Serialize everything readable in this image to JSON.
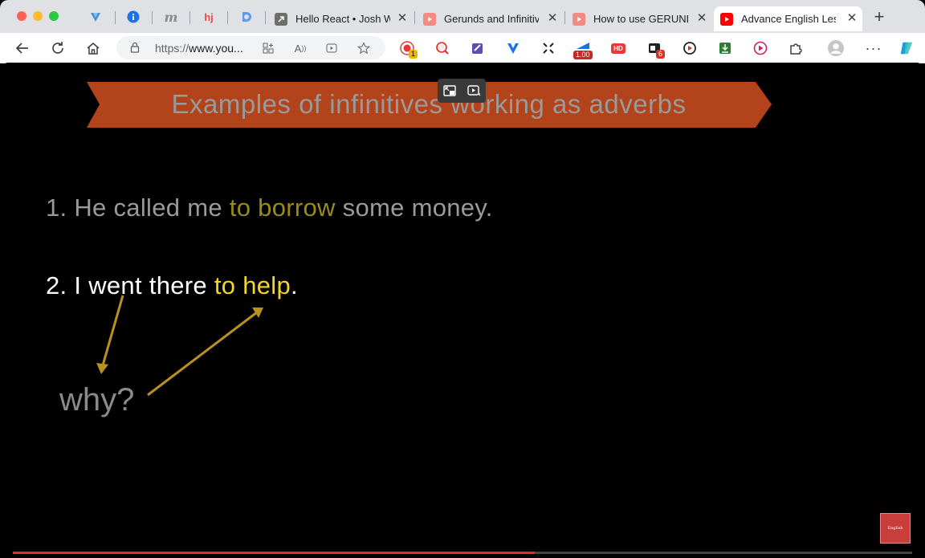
{
  "browser": {
    "tabs": [
      {
        "title": "Hello React • Josh W",
        "favicon": "arrow-icon"
      },
      {
        "title": "Gerunds and Infinitive",
        "favicon": "youtube-icon"
      },
      {
        "title": "How to use GERUNDS",
        "favicon": "youtube-icon"
      },
      {
        "title": "Advance English Lesso",
        "favicon": "youtube-icon",
        "active": true
      }
    ],
    "pinned": [
      "vivaldi-icon",
      "info-icon",
      "m-icon",
      "hj-icon",
      "d-icon"
    ],
    "pinned_text": {
      "m": "m",
      "hj": "hj"
    },
    "address": {
      "scheme": "https://",
      "host": "www.you..."
    },
    "extensions": {
      "badge_1": "1",
      "speed": "1.00",
      "hd": "HD",
      "badge_6": "6"
    },
    "colors": {
      "accent_red": "#e52d27",
      "highlight_yellow": "#f2d62a",
      "banner": "#b3431b"
    }
  },
  "video": {
    "banner_title": "Examples of infinitives working as adverbs",
    "line1_a": "1. He called me ",
    "line1_b": "to borrow",
    "line1_c": " some money.",
    "line2_a": "2. I went there ",
    "line2_b": "to help",
    "line2_c": ".",
    "why": "why?",
    "logo_text": "English",
    "progress_fraction": 0.58
  }
}
